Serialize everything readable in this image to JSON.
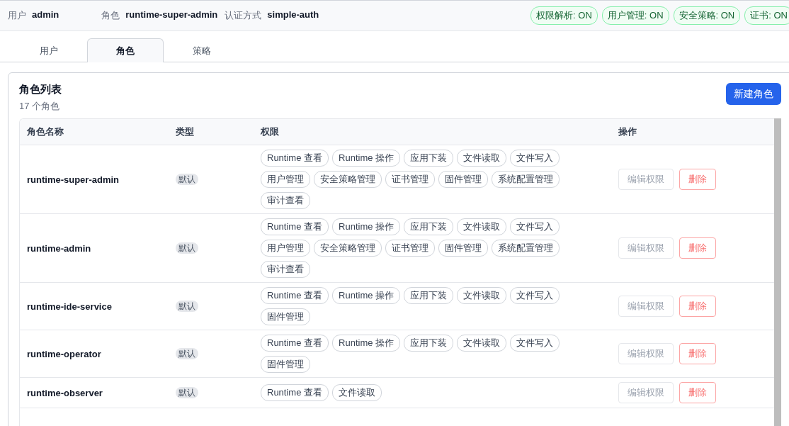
{
  "header": {
    "fields": [
      {
        "label": "用户",
        "value": "admin"
      },
      {
        "label": "角色",
        "value": "runtime-super-admin"
      },
      {
        "label": "认证方式",
        "value": "simple-auth"
      }
    ],
    "badges": [
      "权限解析: ON",
      "用户管理: ON",
      "安全策略: ON",
      "证书: ON"
    ]
  },
  "tabs": [
    {
      "label": "用户",
      "selected": false
    },
    {
      "label": "角色",
      "selected": true
    },
    {
      "label": "策略",
      "selected": false
    }
  ],
  "panel": {
    "title": "角色列表",
    "subtitle": "17 个角色",
    "create_button": "新建角色"
  },
  "table": {
    "columns": [
      "角色名称",
      "类型",
      "权限",
      "操作"
    ],
    "rows": [
      {
        "name": "runtime-super-admin",
        "type": "默认",
        "permissions": [
          "Runtime 查看",
          "Runtime 操作",
          "应用下装",
          "文件读取",
          "文件写入",
          "用户管理",
          "安全策略管理",
          "证书管理",
          "固件管理",
          "系统配置管理",
          "审计查看"
        ],
        "actions": [
          {
            "label": "编辑权限",
            "kind": "edit",
            "disabled": true
          },
          {
            "label": "删除",
            "kind": "delete",
            "disabled": true
          }
        ]
      },
      {
        "name": "runtime-admin",
        "type": "默认",
        "permissions": [
          "Runtime 查看",
          "Runtime 操作",
          "应用下装",
          "文件读取",
          "文件写入",
          "用户管理",
          "安全策略管理",
          "证书管理",
          "固件管理",
          "系统配置管理",
          "审计查看"
        ],
        "actions": [
          {
            "label": "编辑权限",
            "kind": "edit",
            "disabled": true
          },
          {
            "label": "删除",
            "kind": "delete",
            "disabled": true
          }
        ]
      },
      {
        "name": "runtime-ide-service",
        "type": "默认",
        "permissions": [
          "Runtime 查看",
          "Runtime 操作",
          "应用下装",
          "文件读取",
          "文件写入",
          "固件管理"
        ],
        "actions": [
          {
            "label": "编辑权限",
            "kind": "edit",
            "disabled": true
          },
          {
            "label": "删除",
            "kind": "delete",
            "disabled": true
          }
        ]
      },
      {
        "name": "runtime-operator",
        "type": "默认",
        "permissions": [
          "Runtime 查看",
          "Runtime 操作",
          "应用下装",
          "文件读取",
          "文件写入",
          "固件管理"
        ],
        "actions": [
          {
            "label": "编辑权限",
            "kind": "edit",
            "disabled": true
          },
          {
            "label": "删除",
            "kind": "delete",
            "disabled": true
          }
        ]
      },
      {
        "name": "runtime-observer",
        "type": "默认",
        "permissions": [
          "Runtime 查看",
          "文件读取"
        ],
        "actions": [
          {
            "label": "编辑权限",
            "kind": "edit",
            "disabled": true
          },
          {
            "label": "删除",
            "kind": "delete",
            "disabled": true
          }
        ]
      }
    ]
  }
}
